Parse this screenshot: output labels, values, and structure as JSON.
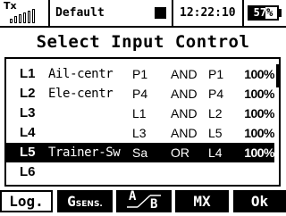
{
  "status": {
    "tx_label": "Tx",
    "signal_icon": "signal-bars-icon",
    "signal_level": 0.6,
    "model_name": "Default",
    "record_icon": "stop-square-icon",
    "clock": "12:22:10",
    "battery_percent": "57%",
    "battery_level": 0.57
  },
  "title": "Select Input Control",
  "rows": [
    {
      "idx": "L1",
      "name": "Ail-centr",
      "src": "P1",
      "op": "AND",
      "src2": "P1",
      "pct": "100%"
    },
    {
      "idx": "L2",
      "name": "Ele-centr",
      "src": "P4",
      "op": "AND",
      "src2": "P4",
      "pct": "100%"
    },
    {
      "idx": "L3",
      "name": "",
      "src": "L1",
      "op": "AND",
      "src2": "L2",
      "pct": "100%"
    },
    {
      "idx": "L4",
      "name": "",
      "src": "L3",
      "op": "AND",
      "src2": "L5",
      "pct": "100%"
    },
    {
      "idx": "L5",
      "name": "Trainer-Sw",
      "src": "Sa",
      "op": "OR",
      "src2": "L4",
      "pct": "100%"
    },
    {
      "idx": "L6",
      "name": "",
      "src": "",
      "op": "",
      "src2": "",
      "pct": ""
    }
  ],
  "selected_row": "L5",
  "softkeys": {
    "log": "Log.",
    "gsens_main": "G",
    "gsens_sub": "SENS.",
    "ab_a": "A",
    "ab_b": "B",
    "mx": "MX",
    "ok": "Ok"
  }
}
